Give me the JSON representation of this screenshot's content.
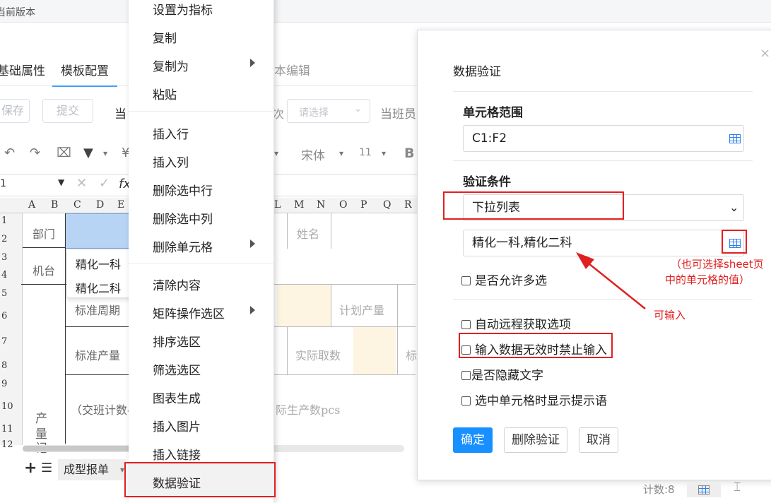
{
  "top": {
    "version_label": "当前版本"
  },
  "tabs": [
    {
      "label": "基础属性"
    },
    {
      "label": "模板配置"
    },
    {
      "label": "本编辑"
    }
  ],
  "actions": {
    "save": "保存",
    "submit": "提交",
    "when_label": "当",
    "shift_label": "次",
    "select_placeholder": "请选择",
    "shift_member": "当班员工"
  },
  "toolbar": {
    "font": "宋体",
    "size": "11",
    "bold": "B",
    "fx": "fx"
  },
  "formula": {
    "cell_ref": "1"
  },
  "columns": [
    "A",
    "B",
    "C",
    "D",
    "E",
    "L",
    "M",
    "N",
    "O",
    "P",
    "Q",
    "R"
  ],
  "rows": [
    "1",
    "2",
    "3",
    "4",
    "5",
    "6",
    "7",
    "8",
    "9",
    "10",
    "11",
    "12"
  ],
  "cells": {
    "dept": "部门",
    "machine": "机台",
    "std_cycle": "标准周期",
    "std_output": "标准产量",
    "formula_text": "（交班计数-",
    "name": "姓名",
    "plan_output": "计划产量",
    "actual_count": "实际取数",
    "biao": "标",
    "actual_pcs": "际生产数pcs",
    "vertical": [
      "产",
      "量",
      "记"
    ]
  },
  "dropdown": {
    "options": [
      "精化一科",
      "精化二科"
    ]
  },
  "context_menu": {
    "items": [
      {
        "label": "设置为指标"
      },
      {
        "label": "复制"
      },
      {
        "label": "复制为",
        "submenu": true
      },
      {
        "label": "粘贴"
      },
      {
        "label": "插入行"
      },
      {
        "label": "插入列"
      },
      {
        "label": "删除选中行"
      },
      {
        "label": "删除选中列"
      },
      {
        "label": "删除单元格",
        "submenu": true
      },
      {
        "label": "清除内容"
      },
      {
        "label": "矩阵操作选区",
        "submenu": true
      },
      {
        "label": "排序选区"
      },
      {
        "label": "筛选选区"
      },
      {
        "label": "图表生成"
      },
      {
        "label": "插入图片"
      },
      {
        "label": "插入链接"
      },
      {
        "label": "数据验证",
        "highlighted": true
      }
    ]
  },
  "sheet_bar": {
    "add": "+",
    "menu": "☰",
    "sheet_name": "成型报单"
  },
  "dialog": {
    "title": "数据验证",
    "range_label": "单元格范围",
    "range_value": "C1:F2",
    "condition_label": "验证条件",
    "condition_value": "下拉列表",
    "list_value": "精化一科,精化二科",
    "allow_multi": "是否允许多选",
    "auto_remote": "自动远程获取选项",
    "forbid_invalid": "输入数据无效时禁止输入",
    "hide_text": "是否隐藏文字",
    "show_hint": "选中单元格时显示提示语",
    "ok": "确定",
    "delete": "删除验证",
    "cancel": "取消",
    "close": "×"
  },
  "annotations": {
    "choose_sheet_line1": "（也可选择sheet页",
    "choose_sheet_line2": "中的单元格的值）",
    "can_input": "可输入"
  },
  "status": {
    "count": "计数:8"
  },
  "colors": {
    "accent": "#1890ff",
    "annotation_red": "#e02020",
    "selection_blue": "#b8d4f5"
  }
}
